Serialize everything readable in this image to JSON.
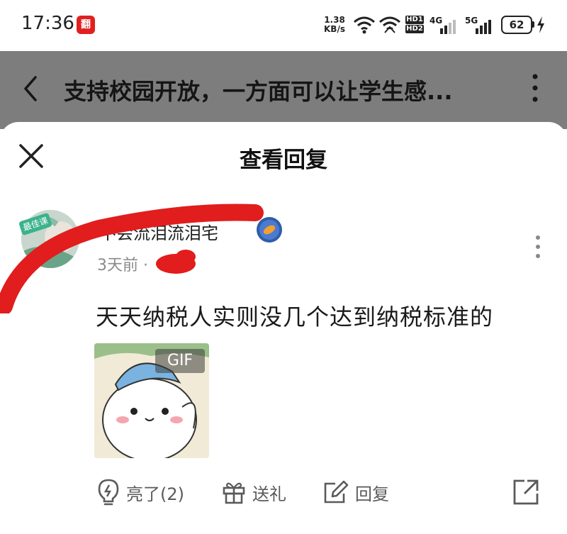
{
  "status_bar": {
    "time": "17:36",
    "app_badge": "翻",
    "net_speed_value": "1.38",
    "net_speed_unit": "KB/s",
    "hd_top": "HD1",
    "hd_bottom": "HD2",
    "sim1_label": "4G",
    "sim2_label": "5G",
    "battery": "62"
  },
  "header": {
    "title": "支持校园开放，一方面可以让学生感..."
  },
  "sheet": {
    "title": "查看回复"
  },
  "comment": {
    "avatar_tag": "最佳课",
    "username": "不会流泪流泪宅",
    "time_ago": "3天前",
    "separator": "·",
    "text": "天天纳税人实则没几个达到纳税标准的",
    "gif_label": "GIF"
  },
  "actions": {
    "like_label": "亮了(2)",
    "gift_label": "送礼",
    "reply_label": "回复"
  },
  "colors": {
    "dim_overlay": "#7d7d7d",
    "scribble": "#e11d1d",
    "icon_gray": "#5a5a5a"
  }
}
